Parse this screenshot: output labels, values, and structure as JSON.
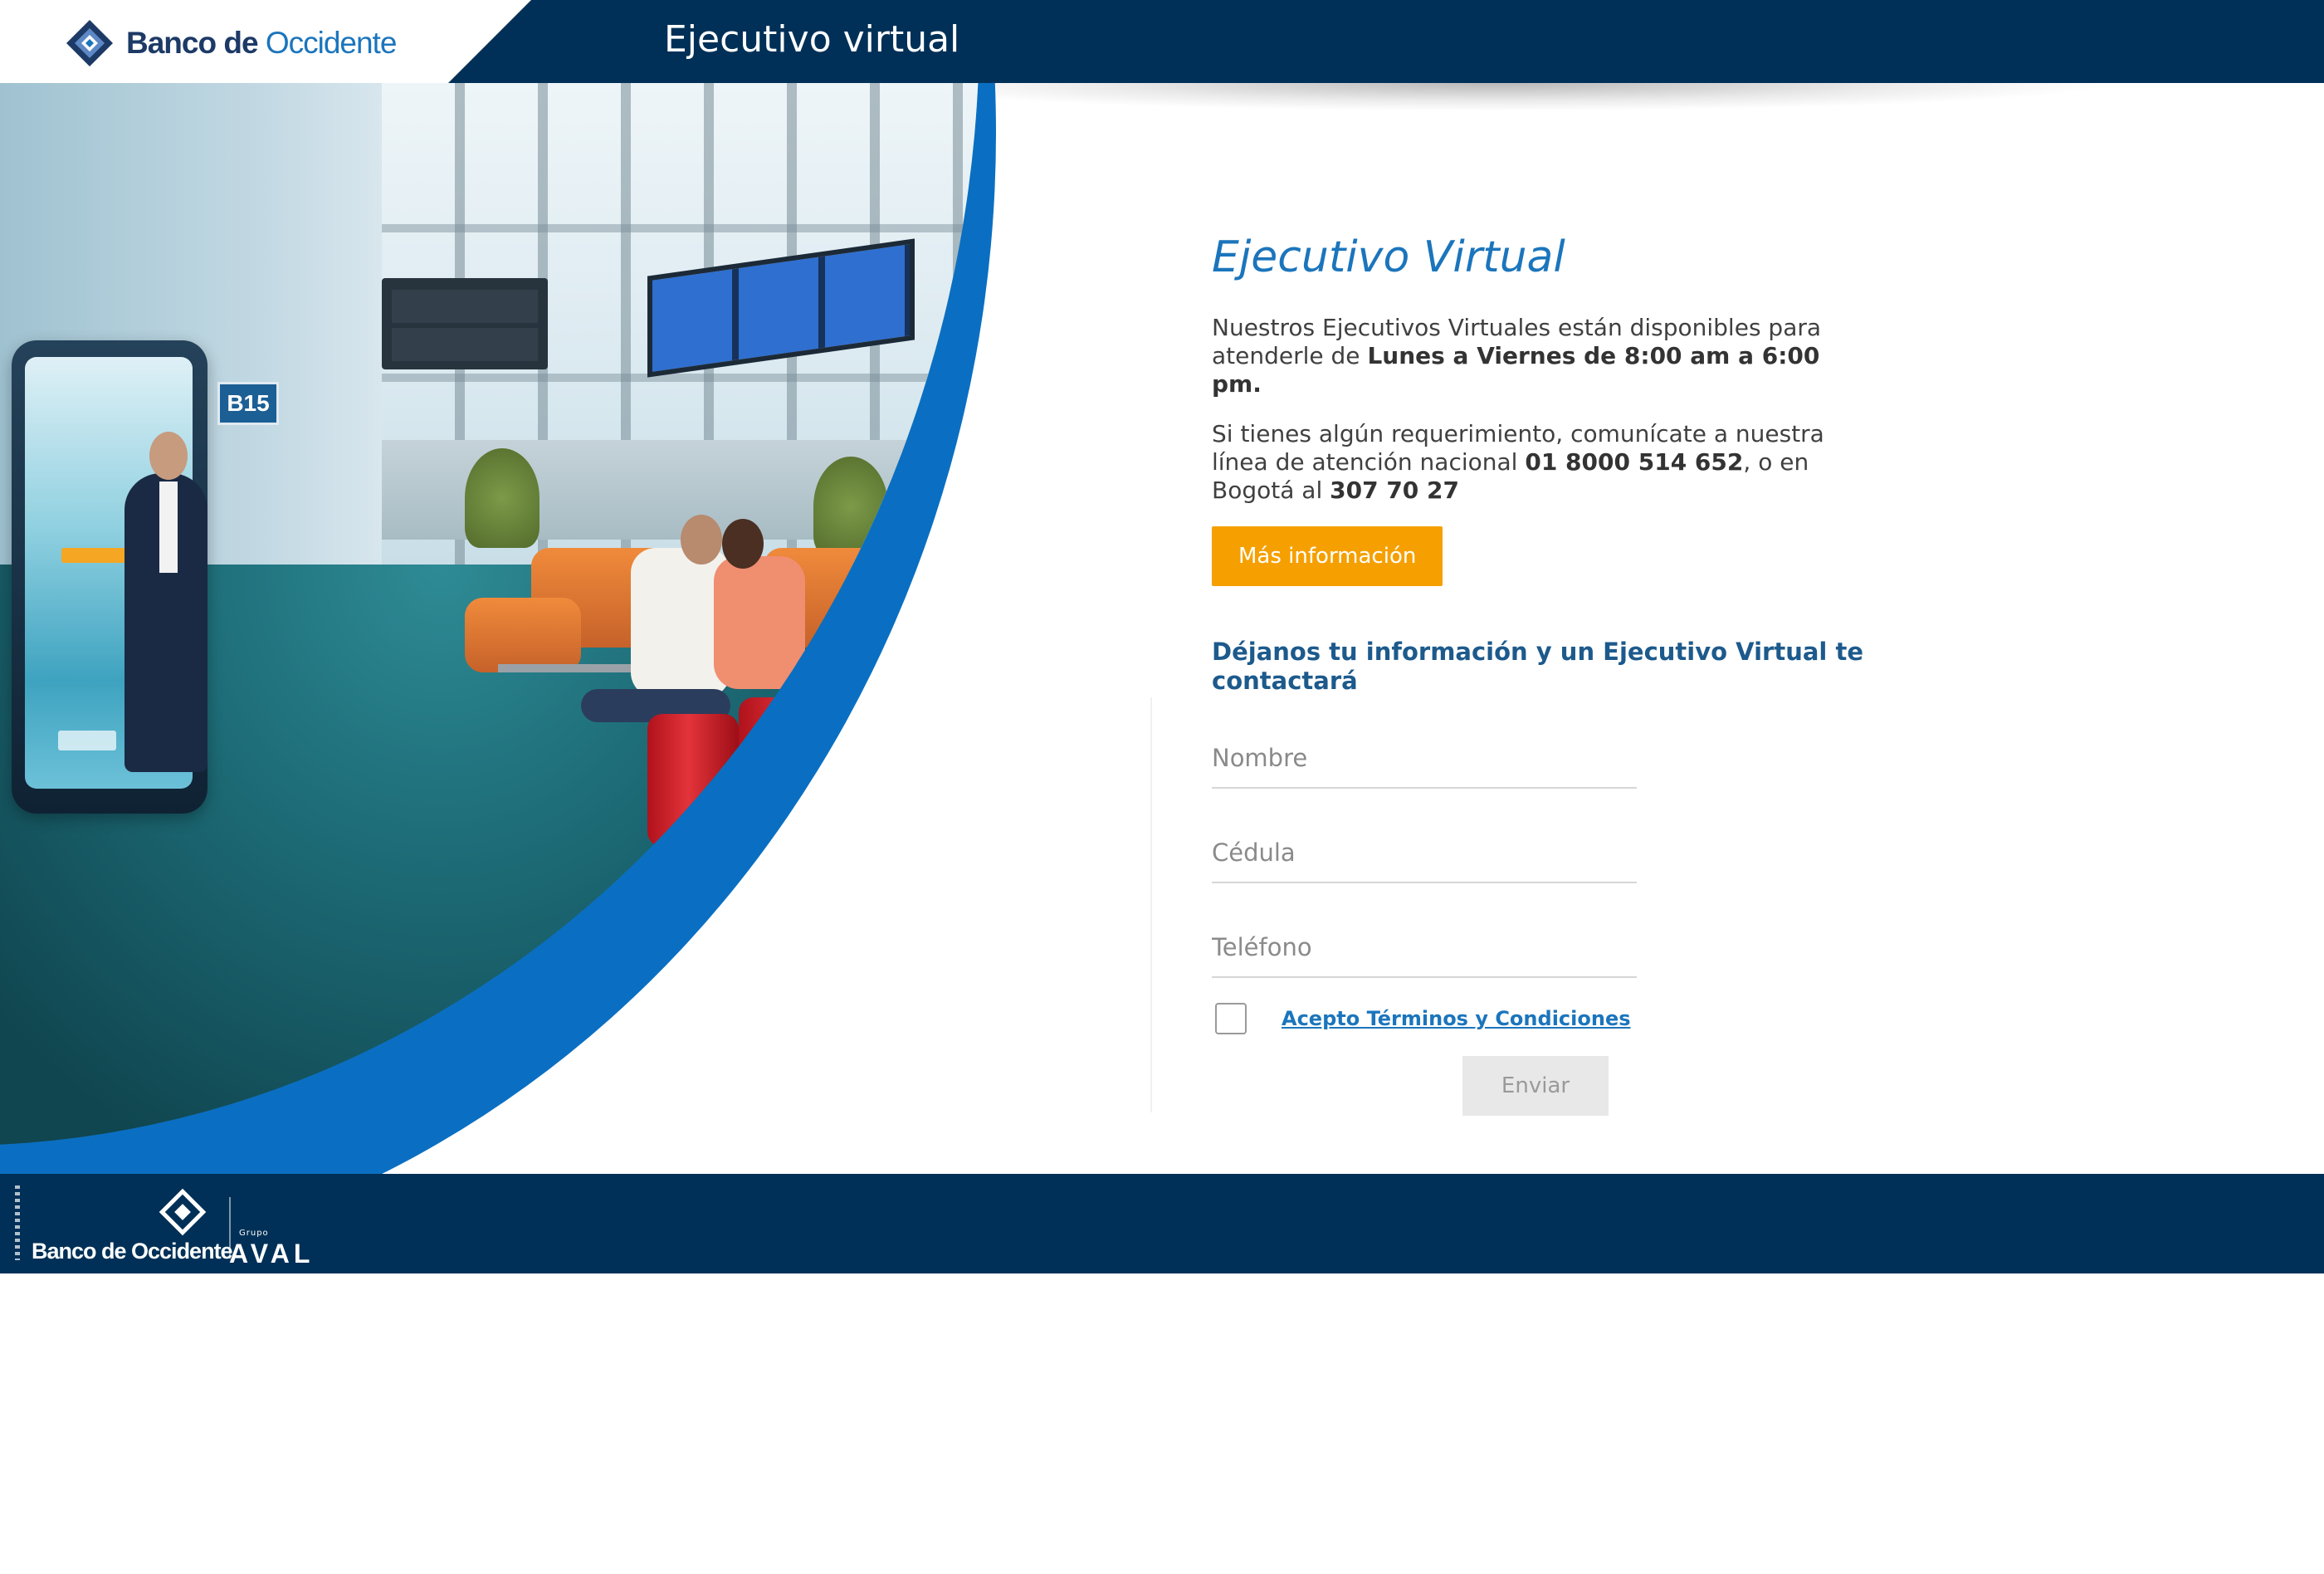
{
  "header": {
    "brand_name": "Banco de",
    "brand_name_accent": "Occidente",
    "title": "Ejecutivo virtual"
  },
  "hero": {
    "gate_sign": "B15"
  },
  "content": {
    "title": "Ejecutivo Virtual",
    "availability_text": "Nuestros Ejecutivos Virtuales están disponibles para atenderle de ",
    "availability_hours": "Lunes a Viernes de 8:00 am a 6:00 pm.",
    "contact_text_1": "Si tienes algún requerimiento, comunícate a nuestra línea de atención nacional ",
    "contact_phone_national": "01 8000 514 652",
    "contact_text_2": ", o en Bogotá al ",
    "contact_phone_bogota": "307 70 27",
    "more_info_label": "Más información",
    "form_title": "Déjanos tu información y un Ejecutivo Virtual te contactará",
    "form": {
      "name_placeholder": "Nombre",
      "name_value": "",
      "id_placeholder": "Cédula",
      "id_value": "",
      "phone_placeholder": "Teléfono",
      "phone_value": "",
      "terms_label": "Acepto Términos y Condiciones",
      "terms_checked": false,
      "submit_label": "Enviar"
    }
  },
  "footer": {
    "brand_name": "Banco de Occidente",
    "group_label": "Grupo",
    "group_name": "AVAL"
  },
  "colors": {
    "navy": "#003057",
    "brand_blue": "#1b75bc",
    "swoop_blue": "#0a6fc2",
    "cta_orange": "#f5a000",
    "form_title": "#1d5a8c"
  },
  "icons": {
    "logo": "diamond-logo-icon",
    "checkbox": "checkbox-icon"
  }
}
